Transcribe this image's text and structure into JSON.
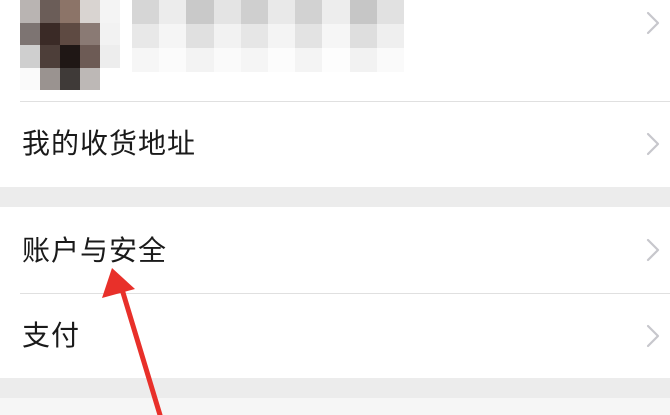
{
  "menu": {
    "address_label": "我的收货地址",
    "security_label": "账户与安全",
    "pay_label": "支付"
  },
  "icons": {
    "chevron": "chevron-right-icon",
    "annotation": "red-arrow"
  },
  "colors": {
    "annotation": "#e8302a",
    "chevron": "#c7c7cc",
    "text": "#1a1a1a",
    "page_background": "#ececec"
  }
}
